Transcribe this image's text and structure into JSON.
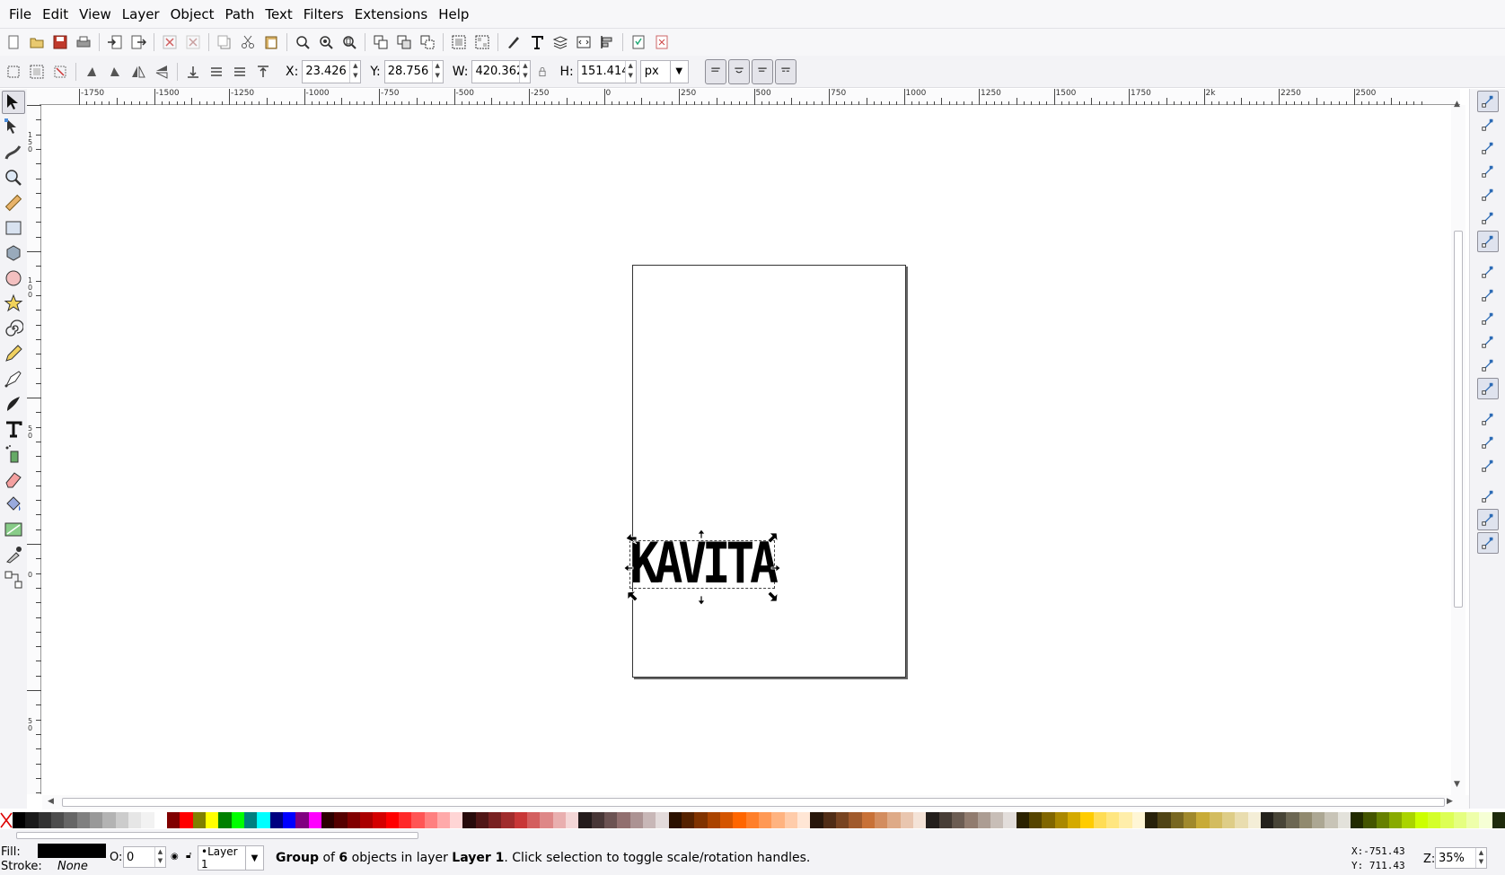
{
  "menu": [
    "File",
    "Edit",
    "View",
    "Layer",
    "Object",
    "Path",
    "Text",
    "Filters",
    "Extensions",
    "Help"
  ],
  "commands": [
    "new-icon",
    "open-icon",
    "save-icon",
    "print-icon",
    "|",
    "import-icon",
    "export-icon",
    "|",
    "undo-icon",
    "redo-icon",
    "|",
    "copy-icon",
    "cut-icon",
    "paste-icon",
    "|",
    "zoom-selection-icon",
    "zoom-drawing-icon",
    "zoom-page-icon",
    "|",
    "duplicate-icon",
    "clone-icon",
    "unlink-clone-icon",
    "|",
    "group-icon",
    "ungroup-icon",
    "|",
    "fill-stroke-icon",
    "text-font-icon",
    "layers-icon",
    "xml-editor-icon",
    "align-icon",
    "|",
    "preferences-icon",
    "document-properties-icon"
  ],
  "controls": {
    "x_label": "X:",
    "x_value": "23.426",
    "y_label": "Y:",
    "y_value": "28.756",
    "w_label": "W:",
    "w_value": "420.362",
    "h_label": "H:",
    "h_value": "151.414",
    "unit": "px"
  },
  "tools": [
    "selector-tool-icon",
    "node-tool-icon",
    "tweak-tool-icon",
    "zoom-tool-icon",
    "measure-tool-icon",
    "rectangle-tool-icon",
    "3d-box-tool-icon",
    "ellipse-tool-icon",
    "star-tool-icon",
    "spiral-tool-icon",
    "pencil-tool-icon",
    "pen-tool-icon",
    "calligraphy-tool-icon",
    "text-tool-icon",
    "spray-tool-icon",
    "eraser-tool-icon",
    "paint-bucket-tool-icon",
    "gradient-tool-icon",
    "dropper-tool-icon",
    "connector-tool-icon"
  ],
  "ruler": {
    "h_ticks": [
      "-1750",
      "-1500",
      "-1250",
      "-1000",
      "-750",
      "-500",
      "-250",
      "0",
      "250",
      "500",
      "750",
      "1000",
      "1250",
      "1500",
      "1750",
      "2k",
      "2250",
      "2500"
    ],
    "v_ticks": [
      "1 5 0",
      "1 0 0",
      "5 0",
      "0",
      "5 0"
    ]
  },
  "canvas": {
    "text": "KAVITA"
  },
  "snap": [
    "snap-enable-icon",
    "snap-bbox-icon",
    "snap-bbox-edge-icon",
    "snap-bbox-corner-icon",
    "snap-bbox-midpoint-icon",
    "snap-bbox-center-icon",
    "snap-nodes-icon",
    "snap-path-icon",
    "snap-path-intersection-icon",
    "snap-cusp-icon",
    "snap-smooth-icon",
    "snap-line-midpoint-icon",
    "snap-others-icon",
    "snap-object-center-icon",
    "snap-rotation-center-icon",
    "snap-text-baseline-icon",
    "snap-page-border-icon",
    "snap-grid-icon",
    "snap-guide-icon"
  ],
  "palette": [
    "#000000",
    "#1a1a1a",
    "#333333",
    "#4d4d4d",
    "#666666",
    "#808080",
    "#999999",
    "#b3b3b3",
    "#cccccc",
    "#e6e6e6",
    "#f2f2f2",
    "#ffffff",
    "#800000",
    "#ff0000",
    "#808000",
    "#ffff00",
    "#008000",
    "#00ff00",
    "#008080",
    "#00ffff",
    "#000080",
    "#0000ff",
    "#800080",
    "#ff00ff",
    "#2b0000",
    "#550000",
    "#800000",
    "#aa0000",
    "#d40000",
    "#ff0000",
    "#ff2a2a",
    "#ff5555",
    "#ff8080",
    "#ffaaaa",
    "#ffd5d5",
    "#280b0b",
    "#501616",
    "#782121",
    "#a02c2c",
    "#c83737",
    "#d35f5f",
    "#de8787",
    "#e9afaf",
    "#f4d7d7",
    "#241c1c",
    "#483737",
    "#6c5353",
    "#916f6f",
    "#ac9393",
    "#c8b7b7",
    "#e3dbdb",
    "#2b1100",
    "#552200",
    "#803300",
    "#aa4400",
    "#d45500",
    "#ff6600",
    "#ff7f2a",
    "#ff9955",
    "#ffb380",
    "#ffccaa",
    "#ffe6d5",
    "#28170b",
    "#502d16",
    "#784421",
    "#a05a2c",
    "#c87137",
    "#d38d5f",
    "#deaa87",
    "#e9c6af",
    "#f4e3d7",
    "#241f1c",
    "#483e37",
    "#6c5d53",
    "#917c6f",
    "#ac9d93",
    "#c8beb7",
    "#e3dedb",
    "#2b2200",
    "#554400",
    "#806600",
    "#aa8800",
    "#d4aa00",
    "#ffcc00",
    "#ffdd55",
    "#ffe680",
    "#ffeeaa",
    "#fff6d5",
    "#28220b",
    "#504416",
    "#786721",
    "#a0892c",
    "#c8ab37",
    "#d3bc5f",
    "#decd87",
    "#e9ddaf",
    "#f4eed7",
    "#24221c",
    "#484537",
    "#6c6753",
    "#918a6f",
    "#aca793",
    "#c8c4b7",
    "#e3e2db",
    "#222b00",
    "#445500",
    "#668000",
    "#88aa00",
    "#aad400",
    "#ccff00",
    "#d4ff2a",
    "#ddff55",
    "#e5ff80",
    "#eeffaa",
    "#f6ffd5",
    "#1f2b0b"
  ],
  "status": {
    "fill_label": "Fill:",
    "fill_color": "#000000",
    "stroke_label": "Stroke:",
    "stroke_value": "None",
    "opacity_label": "O:",
    "opacity_value": "0",
    "layer_name": "•Layer 1",
    "msg_group": "Group",
    "msg_of": " of ",
    "msg_count": "6",
    "msg_mid": " objects in layer ",
    "msg_layer": "Layer 1",
    "msg_tail": ". Click selection to toggle scale/rotation handles.",
    "cursor_x": "X:-751.43",
    "cursor_y": "Y: 711.43",
    "zoom_label": "Z:",
    "zoom_value": "35%"
  }
}
